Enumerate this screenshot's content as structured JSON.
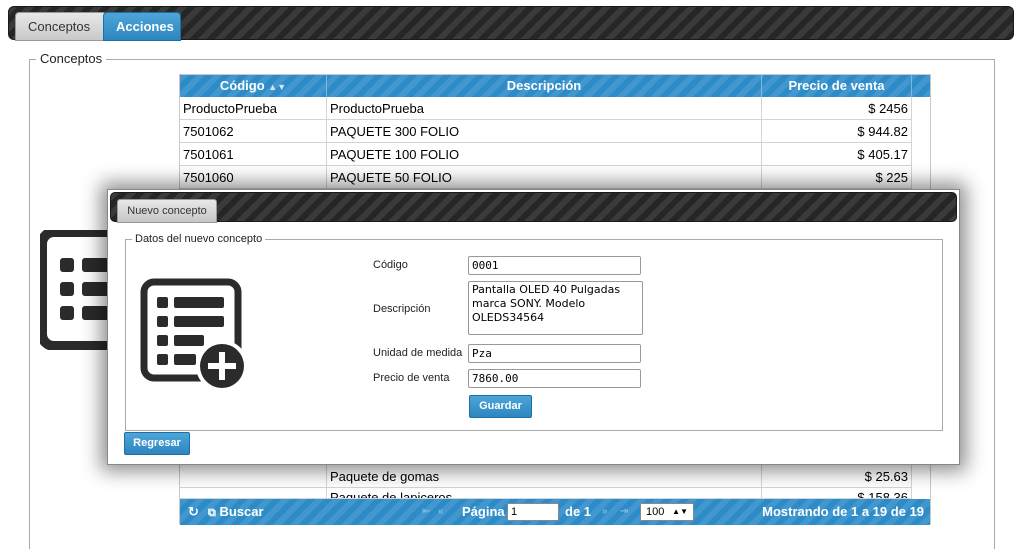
{
  "tabs": [
    {
      "label": "Conceptos",
      "active": false
    },
    {
      "label": "Acciones",
      "active": true
    }
  ],
  "conceptos_section": {
    "legend": "Conceptos"
  },
  "grid": {
    "columns": [
      "Código",
      "Descripción",
      "Precio de venta"
    ],
    "sort_indicator": "sort-icon",
    "rows_top": [
      [
        "ProductoPrueba",
        "ProductoPrueba",
        "$ 2456"
      ],
      [
        "7501062",
        "PAQUETE 300 FOLIO",
        "$ 944.82"
      ],
      [
        "7501061",
        "PAQUETE 100 FOLIO",
        "$ 405.17"
      ],
      [
        "7501060",
        "PAQUETE 50 FOLIO",
        "$ 225"
      ]
    ],
    "rows_bottom": [
      [
        "",
        "Paquete de gomas",
        "$ 25.63"
      ],
      [
        "",
        "Paquete de lapiceros",
        "$ 158.36"
      ]
    ],
    "footer": {
      "refresh_icon": "refresh-icon",
      "search_label": "Buscar",
      "page_label": "Página",
      "page_value": "1",
      "of_label": "de 1",
      "rows_per_page": "100",
      "showing": "Mostrando de 1 a 19 de 19"
    }
  },
  "modal": {
    "tab_label": "Nuevo concepto",
    "legend": "Datos del nuevo concepto",
    "fields": {
      "codigo_label": "Código",
      "codigo_value": "0001",
      "descripcion_label": "Descripción",
      "descripcion_value": "Pantalla OLED 40 Pulgadas\nmarca SONY. Modelo\nOLEDS34564",
      "unidad_label": "Unidad de medida",
      "unidad_value": "Pza",
      "precio_label": "Precio de venta",
      "precio_value": "7860.00"
    },
    "save_label": "Guardar",
    "back_label": "Regresar"
  },
  "colors": {
    "accent": "#2d8cc8",
    "bar": "#2f2f2f"
  }
}
